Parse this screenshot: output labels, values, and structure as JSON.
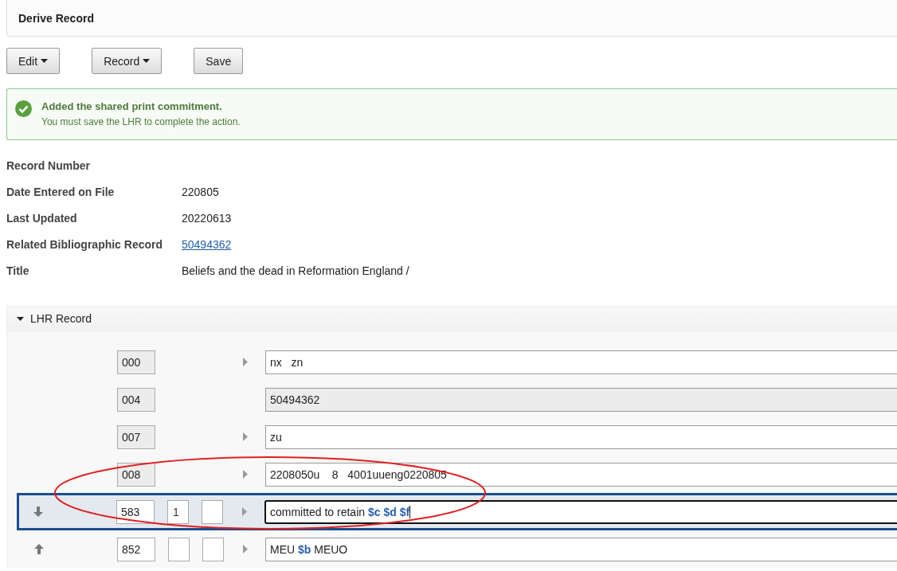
{
  "header": {
    "title": "Derive Record"
  },
  "toolbar": [
    {
      "label": "Edit",
      "kind": "menu"
    },
    {
      "label": "Record",
      "kind": "menu"
    },
    {
      "label": "Save",
      "kind": "plain"
    }
  ],
  "alert": {
    "kind": "success",
    "title": "Added the shared print commitment.",
    "message": "You must save the LHR to complete the action."
  },
  "fields": [
    {
      "label": "Record Number"
    },
    {
      "label": "Date Entered on File",
      "value": "220805"
    },
    {
      "label": "Last Updated",
      "value": "20220613"
    },
    {
      "label": "Related Bibliographic Record",
      "value": "50494362",
      "kind": "link"
    },
    {
      "label": "Title",
      "value": "Beliefs and the dead in Reformation England /"
    }
  ],
  "lhr": {
    "title": "LHR Record",
    "expanded": true,
    "rows": [
      {
        "tag": "000",
        "tag_locked": true,
        "has_indicators": false,
        "expandable": true,
        "content": "nx   zn",
        "content_locked": false,
        "selected": false,
        "can_move_down": false,
        "can_move_up": false
      },
      {
        "tag": "004",
        "tag_locked": true,
        "has_indicators": false,
        "expandable": false,
        "content": "50494362",
        "content_locked": true,
        "selected": false,
        "can_move_down": false,
        "can_move_up": false
      },
      {
        "tag": "007",
        "tag_locked": true,
        "has_indicators": false,
        "expandable": true,
        "content": "zu",
        "content_locked": false,
        "selected": false,
        "can_move_down": false,
        "can_move_up": false
      },
      {
        "tag": "008",
        "tag_locked": true,
        "has_indicators": false,
        "expandable": true,
        "content": "2208050u    8   4001uueng0220805",
        "content_locked": false,
        "selected": false,
        "can_move_down": false,
        "can_move_up": false
      },
      {
        "tag": "583",
        "tag_locked": false,
        "has_indicators": true,
        "ind1": "1",
        "expandable": true,
        "content": "committed to retain **$c** **$d** **$f**",
        "content_locked": false,
        "selected": true,
        "can_move_down": true,
        "can_move_up": false
      },
      {
        "tag": "852",
        "tag_locked": false,
        "has_indicators": true,
        "expandable": true,
        "content": "MEU **$b** MEUO",
        "content_locked": false,
        "selected": false,
        "can_move_down": false,
        "can_move_up": true
      }
    ]
  },
  "annotation": {
    "kind": "ellipse",
    "color": "#e02020"
  }
}
